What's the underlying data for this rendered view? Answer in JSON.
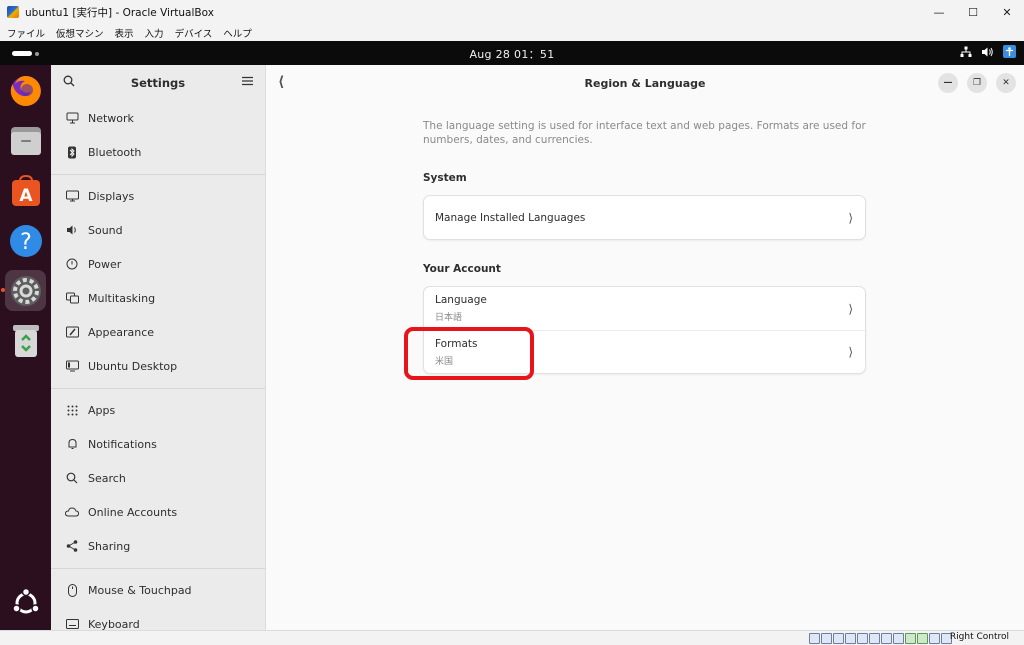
{
  "vbox": {
    "title": "ubuntu1 [実行中] - Oracle VirtualBox",
    "menu": [
      "ファイル",
      "仮想マシン",
      "表示",
      "入力",
      "デバイス",
      "ヘルプ"
    ],
    "host_key": "Right Control"
  },
  "topbar": {
    "clock": "Aug 28  01：51"
  },
  "dock": {
    "items": [
      {
        "name": "firefox",
        "icon": "firefox-icon"
      },
      {
        "name": "files",
        "icon": "files-icon"
      },
      {
        "name": "app-center",
        "icon": "app-center-icon"
      },
      {
        "name": "help",
        "icon": "help-icon"
      },
      {
        "name": "settings",
        "icon": "settings-icon",
        "active": true
      },
      {
        "name": "trash",
        "icon": "trash-icon"
      },
      {
        "name": "show-apps",
        "icon": "ubuntu-apps-icon"
      }
    ]
  },
  "sidebar": {
    "title": "Settings",
    "items": [
      {
        "label": "Network",
        "icon": "network-icon"
      },
      {
        "label": "Bluetooth",
        "icon": "bluetooth-icon"
      },
      {
        "label": "Displays",
        "icon": "display-icon"
      },
      {
        "label": "Sound",
        "icon": "sound-icon"
      },
      {
        "label": "Power",
        "icon": "power-icon"
      },
      {
        "label": "Multitasking",
        "icon": "multitasking-icon"
      },
      {
        "label": "Appearance",
        "icon": "appearance-icon"
      },
      {
        "label": "Ubuntu Desktop",
        "icon": "ubuntu-desktop-icon"
      },
      {
        "label": "Apps",
        "icon": "apps-icon"
      },
      {
        "label": "Notifications",
        "icon": "bell-icon"
      },
      {
        "label": "Search",
        "icon": "search-icon"
      },
      {
        "label": "Online Accounts",
        "icon": "cloud-icon"
      },
      {
        "label": "Sharing",
        "icon": "share-icon"
      },
      {
        "label": "Mouse & Touchpad",
        "icon": "mouse-icon"
      },
      {
        "label": "Keyboard",
        "icon": "keyboard-icon"
      }
    ]
  },
  "main": {
    "title": "Region & Language",
    "description": "The language setting is used for interface text and web pages. Formats are used for numbers, dates, and currencies.",
    "system": {
      "heading": "System",
      "manage_label": "Manage Installed Languages"
    },
    "account": {
      "heading": "Your Account",
      "language_label": "Language",
      "language_value": "日本語",
      "formats_label": "Formats",
      "formats_value": "米国"
    }
  },
  "colors": {
    "accent": "#e95420",
    "highlight": "#e8141c",
    "dock_bg": "#2b0f1f"
  }
}
